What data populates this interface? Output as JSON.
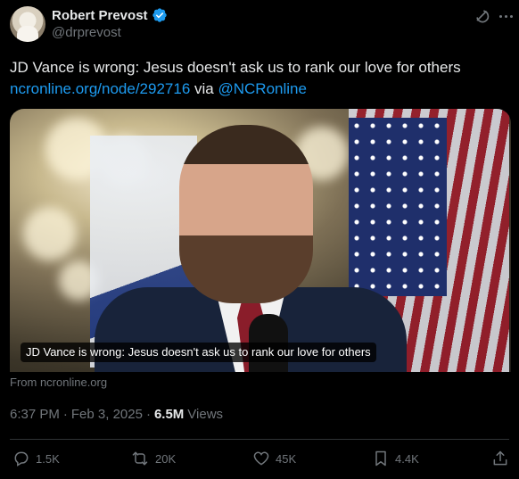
{
  "author": {
    "display_name": "Robert Prevost",
    "handle": "@drprevost",
    "verified": true
  },
  "tweet": {
    "text": "JD Vance is wrong: Jesus doesn't ask us to rank our love for others",
    "link_text": "ncronline.org/node/292716",
    "via_text": "via",
    "mention": "@NCRonline"
  },
  "card": {
    "caption": "JD Vance is wrong: Jesus doesn't ask us to rank our love for others",
    "source": "From ncronline.org"
  },
  "meta": {
    "time": "6:37 PM",
    "separator": "·",
    "date": "Feb 3, 2025",
    "views_count": "6.5M",
    "views_label": "Views"
  },
  "actions": {
    "reply_count": "1.5K",
    "repost_count": "20K",
    "like_count": "45K",
    "bookmark_count": "4.4K"
  },
  "colors": {
    "background": "#000000",
    "text_primary": "#e7e9ea",
    "text_secondary": "#71767b",
    "link": "#1d9bf0",
    "verified": "#1d9bf0"
  },
  "icons": [
    "avatar",
    "verified-badge-icon",
    "grok-icon",
    "more-icon",
    "reply-icon",
    "repost-icon",
    "like-icon",
    "bookmark-icon",
    "share-icon"
  ]
}
